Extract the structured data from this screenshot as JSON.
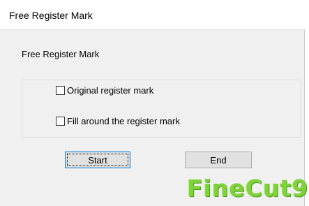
{
  "window": {
    "title": "Free Register Mark"
  },
  "dialog": {
    "heading": "Free Register Mark",
    "options": [
      {
        "label": "Original register mark",
        "checked": false
      },
      {
        "label": "Fill around the register mark",
        "checked": false
      }
    ],
    "start_label": "Start",
    "end_label": "End"
  },
  "logo": {
    "text": "FineCut9",
    "color": "#7ed23a"
  }
}
